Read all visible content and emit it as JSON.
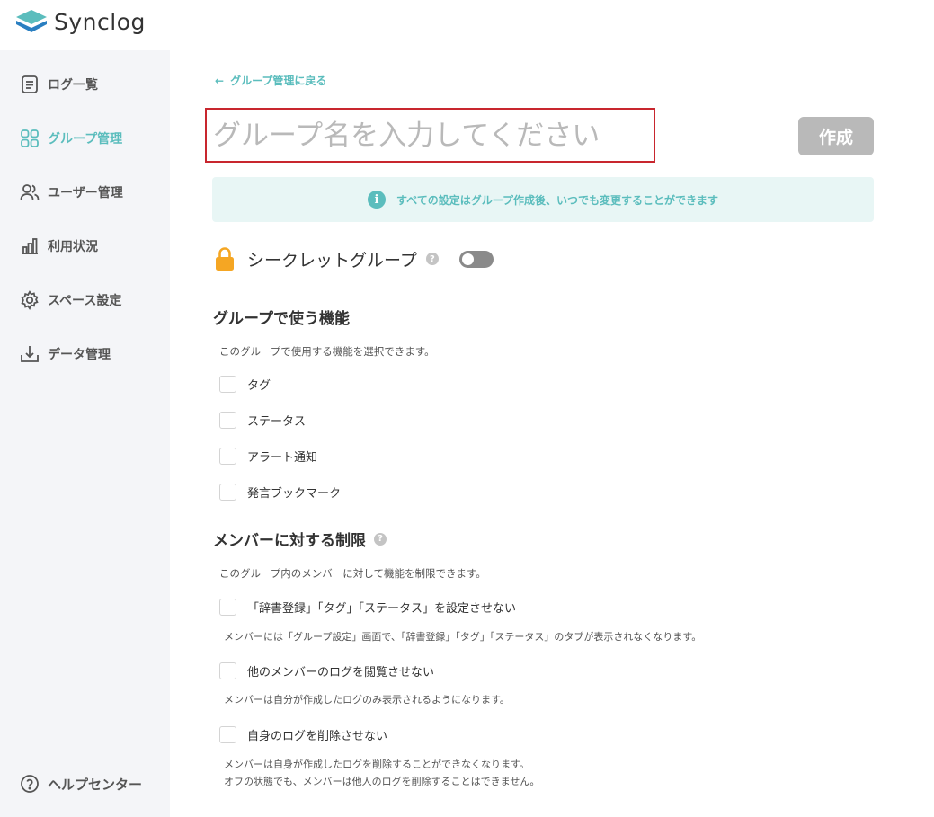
{
  "app": {
    "name": "Synclog",
    "brand_color": "#5bbdbd"
  },
  "sidebar": {
    "items": [
      {
        "label": "ログ一覧",
        "icon": "document-list-icon"
      },
      {
        "label": "グループ管理",
        "icon": "grid-icon",
        "active": true
      },
      {
        "label": "ユーザー管理",
        "icon": "users-icon"
      },
      {
        "label": "利用状況",
        "icon": "bar-chart-icon"
      },
      {
        "label": "スペース設定",
        "icon": "gear-icon"
      },
      {
        "label": "データ管理",
        "icon": "download-tray-icon"
      }
    ],
    "help": {
      "label": "ヘルプセンター",
      "icon": "help-circle-icon"
    }
  },
  "main": {
    "back_link": "グループ管理に戻る",
    "group_name": {
      "value": "",
      "placeholder": "グループ名を入力してください"
    },
    "create_button": "作成",
    "info_banner": "すべての設定はグループ作成後、いつでも変更することができます",
    "secret": {
      "label": "シークレットグループ",
      "enabled": false
    },
    "features": {
      "title": "グループで使う機能",
      "description": "このグループで使用する機能を選択できます。",
      "options": [
        {
          "label": "タグ",
          "checked": false
        },
        {
          "label": "ステータス",
          "checked": false
        },
        {
          "label": "アラート通知",
          "checked": false
        },
        {
          "label": "発言ブックマーク",
          "checked": false
        }
      ]
    },
    "restrictions": {
      "title": "メンバーに対する制限",
      "description": "このグループ内のメンバーに対して機能を制限できます。",
      "options": [
        {
          "label": "「辞書登録」「タグ」「ステータス」を設定させない",
          "checked": false,
          "note": "メンバーには「グループ設定」画面で、「辞書登録」「タグ」「ステータス」のタブが表示されなくなります。"
        },
        {
          "label": "他のメンバーのログを閲覧させない",
          "checked": false,
          "note": "メンバーは自分が作成したログのみ表示されるようになります。"
        },
        {
          "label": "自身のログを削除させない",
          "checked": false,
          "note": "メンバーは自身が作成したログを削除することができなくなります。",
          "note2": "オフの状態でも、メンバーは他人のログを削除することはできません。"
        }
      ]
    }
  }
}
